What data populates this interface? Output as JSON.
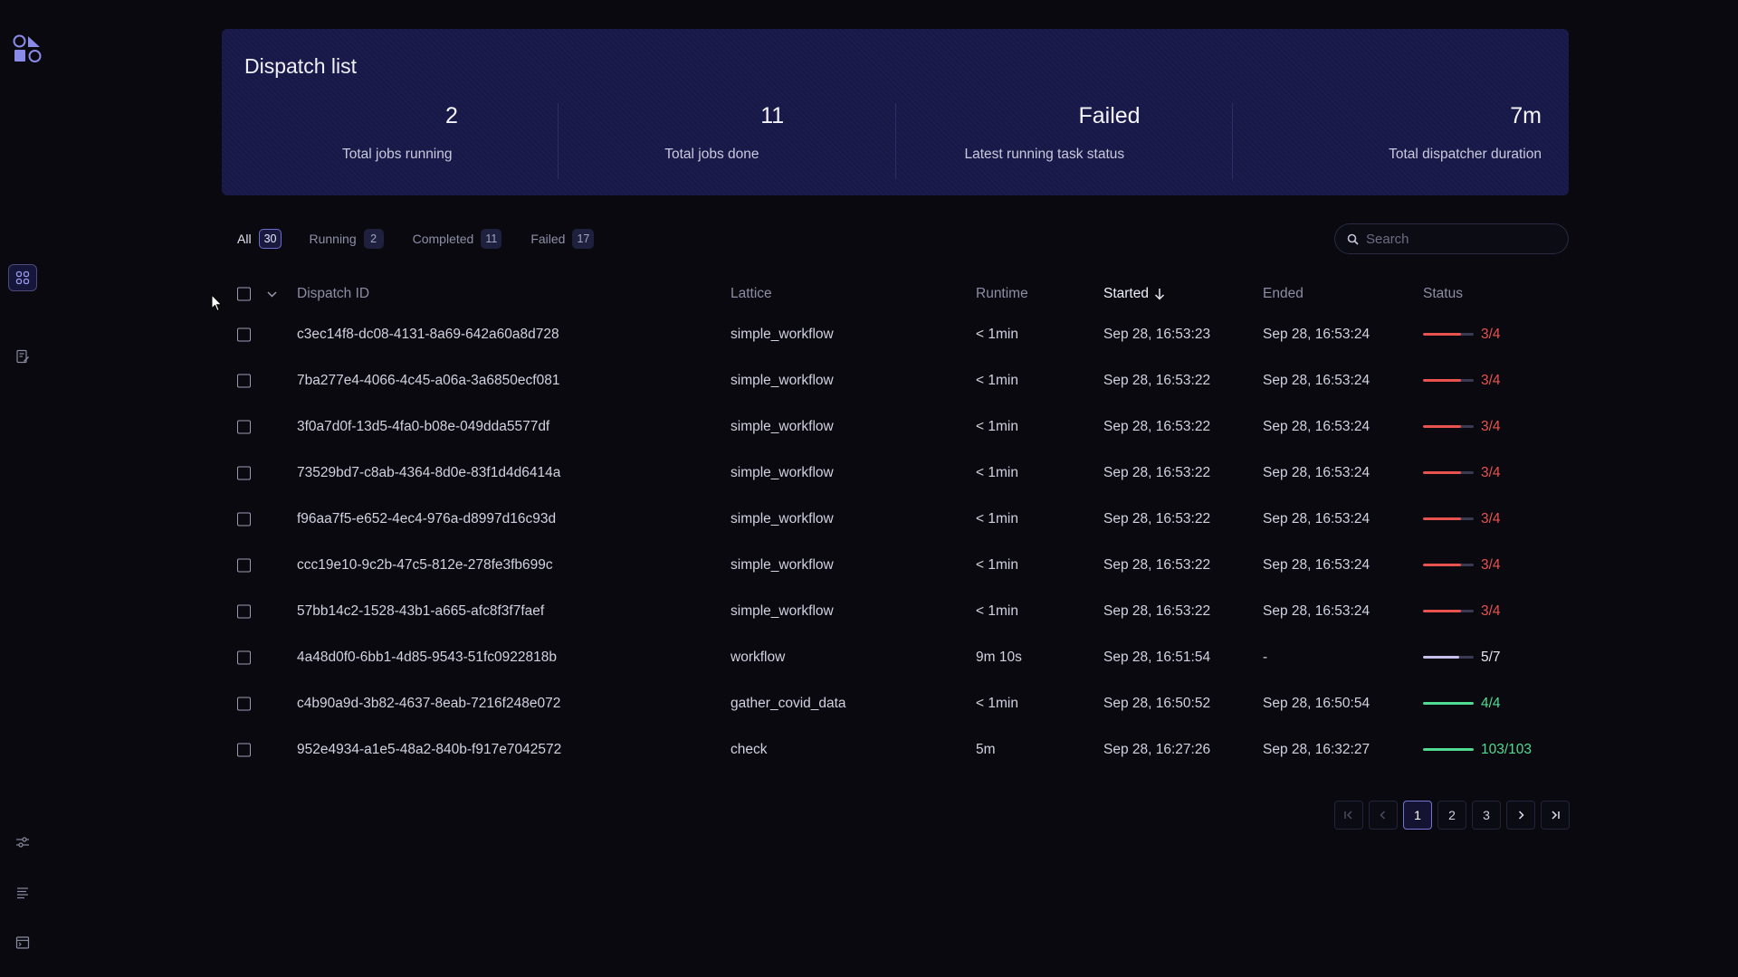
{
  "header": {
    "title": "Dispatch list",
    "stats": [
      {
        "value": "2",
        "label": "Total jobs running"
      },
      {
        "value": "11",
        "label": "Total jobs done"
      },
      {
        "value": "Failed",
        "label": "Latest running task status"
      },
      {
        "value": "7m",
        "label": "Total dispatcher duration"
      }
    ]
  },
  "tabs": [
    {
      "label": "All",
      "count": "30"
    },
    {
      "label": "Running",
      "count": "2"
    },
    {
      "label": "Completed",
      "count": "11"
    },
    {
      "label": "Failed",
      "count": "17"
    }
  ],
  "search": {
    "placeholder": "Search"
  },
  "table": {
    "columns": {
      "id": "Dispatch ID",
      "lattice": "Lattice",
      "runtime": "Runtime",
      "started": "Started",
      "ended": "Ended",
      "status": "Status"
    },
    "rows": [
      {
        "id": "c3ec14f8-dc08-4131-8a69-642a60a8d728",
        "lattice": "simple_workflow",
        "runtime": "< 1min",
        "started": "Sep 28, 16:53:23",
        "ended": "Sep 28, 16:53:24",
        "status": "3/4",
        "progress": 0.75,
        "state": "failed"
      },
      {
        "id": "7ba277e4-4066-4c45-a06a-3a6850ecf081",
        "lattice": "simple_workflow",
        "runtime": "< 1min",
        "started": "Sep 28, 16:53:22",
        "ended": "Sep 28, 16:53:24",
        "status": "3/4",
        "progress": 0.75,
        "state": "failed"
      },
      {
        "id": "3f0a7d0f-13d5-4fa0-b08e-049dda5577df",
        "lattice": "simple_workflow",
        "runtime": "< 1min",
        "started": "Sep 28, 16:53:22",
        "ended": "Sep 28, 16:53:24",
        "status": "3/4",
        "progress": 0.75,
        "state": "failed"
      },
      {
        "id": "73529bd7-c8ab-4364-8d0e-83f1d4d6414a",
        "lattice": "simple_workflow",
        "runtime": "< 1min",
        "started": "Sep 28, 16:53:22",
        "ended": "Sep 28, 16:53:24",
        "status": "3/4",
        "progress": 0.75,
        "state": "failed"
      },
      {
        "id": "f96aa7f5-e652-4ec4-976a-d8997d16c93d",
        "lattice": "simple_workflow",
        "runtime": "< 1min",
        "started": "Sep 28, 16:53:22",
        "ended": "Sep 28, 16:53:24",
        "status": "3/4",
        "progress": 0.75,
        "state": "failed"
      },
      {
        "id": "ccc19e10-9c2b-47c5-812e-278fe3fb699c",
        "lattice": "simple_workflow",
        "runtime": "< 1min",
        "started": "Sep 28, 16:53:22",
        "ended": "Sep 28, 16:53:24",
        "status": "3/4",
        "progress": 0.75,
        "state": "failed"
      },
      {
        "id": "57bb14c2-1528-43b1-a665-afc8f3f7faef",
        "lattice": "simple_workflow",
        "runtime": "< 1min",
        "started": "Sep 28, 16:53:22",
        "ended": "Sep 28, 16:53:24",
        "status": "3/4",
        "progress": 0.75,
        "state": "failed"
      },
      {
        "id": "4a48d0f0-6bb1-4d85-9543-51fc0922818b",
        "lattice": "workflow",
        "runtime": "9m 10s",
        "started": "Sep 28, 16:51:54",
        "ended": "-",
        "status": "5/7",
        "progress": 0.714,
        "state": "running"
      },
      {
        "id": "c4b90a9d-3b82-4637-8eab-7216f248e072",
        "lattice": "gather_covid_data",
        "runtime": "< 1min",
        "started": "Sep 28, 16:50:52",
        "ended": "Sep 28, 16:50:54",
        "status": "4/4",
        "progress": 1.0,
        "state": "completed"
      },
      {
        "id": "952e4934-a1e5-48a2-840b-f917e7042572",
        "lattice": "check",
        "runtime": "5m",
        "started": "Sep 28, 16:27:26",
        "ended": "Sep 28, 16:32:27",
        "status": "103/103",
        "progress": 1.0,
        "state": "completed"
      }
    ]
  },
  "pagination": {
    "pages": [
      "1",
      "2",
      "3"
    ],
    "current": "1"
  },
  "colors": {
    "failed": "#e8524f",
    "running": "#c8c0ec",
    "completed": "#4fdc92",
    "accent": "#6b6bd6"
  },
  "icons": {
    "sort": "arrow-down-icon",
    "search": "search-icon",
    "sidebar": [
      "dashboard-icon",
      "notes-icon",
      "settings-icon",
      "logs-icon",
      "terminal-icon"
    ]
  }
}
